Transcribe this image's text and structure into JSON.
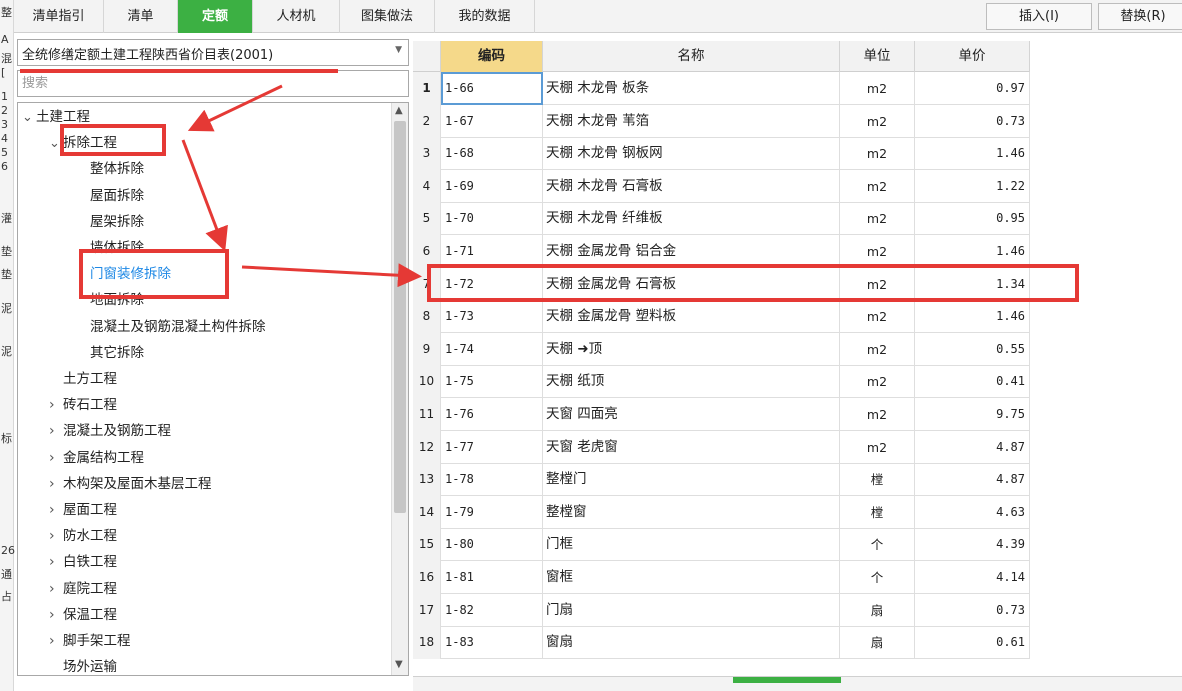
{
  "tabs": [
    {
      "label": "清单指引",
      "active": false
    },
    {
      "label": "清单",
      "active": false
    },
    {
      "label": "定额",
      "active": true
    },
    {
      "label": "人材机",
      "active": false
    },
    {
      "label": "图集做法",
      "active": false
    },
    {
      "label": "我的数据",
      "active": false
    }
  ],
  "toolbar": {
    "insert_label": "插入(I)",
    "replace_label": "替换(R)"
  },
  "edge_strip": [
    "整",
    "A",
    "混",
    "[",
    "1",
    "2",
    "3",
    "4",
    "5",
    "6",
    "灌",
    "垫",
    "垫",
    "泥",
    "泥",
    "标",
    "26",
    "通",
    "占"
  ],
  "library": {
    "selected": "全统修缮定额土建工程陕西省价目表(2001)"
  },
  "search": {
    "placeholder": "搜索"
  },
  "tree": [
    {
      "label": "土建工程",
      "level": 0,
      "chevron": "down"
    },
    {
      "label": "拆除工程",
      "level": 1,
      "chevron": "down"
    },
    {
      "label": "整体拆除",
      "level": 2,
      "chevron": ""
    },
    {
      "label": "屋面拆除",
      "level": 2,
      "chevron": ""
    },
    {
      "label": "屋架拆除",
      "level": 2,
      "chevron": ""
    },
    {
      "label": "墙体拆除",
      "level": 2,
      "chevron": ""
    },
    {
      "label": "门窗装修拆除",
      "level": 2,
      "chevron": "",
      "selected": true
    },
    {
      "label": "地面拆除",
      "level": 2,
      "chevron": ""
    },
    {
      "label": "混凝土及钢筋混凝土构件拆除",
      "level": 2,
      "chevron": ""
    },
    {
      "label": "其它拆除",
      "level": 2,
      "chevron": ""
    },
    {
      "label": "土方工程",
      "level": 1,
      "chevron": ""
    },
    {
      "label": "砖石工程",
      "level": 1,
      "chevron": "right"
    },
    {
      "label": "混凝土及钢筋工程",
      "level": 1,
      "chevron": "right"
    },
    {
      "label": "金属结构工程",
      "level": 1,
      "chevron": "right"
    },
    {
      "label": "木构架及屋面木基层工程",
      "level": 1,
      "chevron": "right"
    },
    {
      "label": "屋面工程",
      "level": 1,
      "chevron": "right"
    },
    {
      "label": "防水工程",
      "level": 1,
      "chevron": "right"
    },
    {
      "label": "白铁工程",
      "level": 1,
      "chevron": "right"
    },
    {
      "label": "庭院工程",
      "level": 1,
      "chevron": "right"
    },
    {
      "label": "保温工程",
      "level": 1,
      "chevron": "right"
    },
    {
      "label": "脚手架工程",
      "level": 1,
      "chevron": "right"
    },
    {
      "label": "场外运输",
      "level": 1,
      "chevron": ""
    }
  ],
  "grid": {
    "headers": {
      "code": "编码",
      "name": "名称",
      "unit": "单位",
      "price": "单价"
    },
    "rows": [
      {
        "idx": "1",
        "code": "1-66",
        "name": "天棚 木龙骨 板条",
        "unit": "m2",
        "price": "0.97"
      },
      {
        "idx": "2",
        "code": "1-67",
        "name": "天棚 木龙骨 苇箔",
        "unit": "m2",
        "price": "0.73"
      },
      {
        "idx": "3",
        "code": "1-68",
        "name": "天棚 木龙骨 钢板网",
        "unit": "m2",
        "price": "1.46"
      },
      {
        "idx": "4",
        "code": "1-69",
        "name": "天棚 木龙骨 石膏板",
        "unit": "m2",
        "price": "1.22"
      },
      {
        "idx": "5",
        "code": "1-70",
        "name": "天棚 木龙骨 纤维板",
        "unit": "m2",
        "price": "0.95"
      },
      {
        "idx": "6",
        "code": "1-71",
        "name": "天棚 金属龙骨 铝合金",
        "unit": "m2",
        "price": "1.46"
      },
      {
        "idx": "7",
        "code": "1-72",
        "name": "天棚 金属龙骨 石膏板",
        "unit": "m2",
        "price": "1.34"
      },
      {
        "idx": "8",
        "code": "1-73",
        "name": "天棚 金属龙骨 塑料板",
        "unit": "m2",
        "price": "1.46"
      },
      {
        "idx": "9",
        "code": "1-74",
        "name": "天棚 ➜顶",
        "unit": "m2",
        "price": "0.55"
      },
      {
        "idx": "10",
        "code": "1-75",
        "name": "天棚 纸顶",
        "unit": "m2",
        "price": "0.41"
      },
      {
        "idx": "11",
        "code": "1-76",
        "name": "天窗 四面亮",
        "unit": "m2",
        "price": "9.75"
      },
      {
        "idx": "12",
        "code": "1-77",
        "name": "天窗 老虎窗",
        "unit": "m2",
        "price": "4.87"
      },
      {
        "idx": "13",
        "code": "1-78",
        "name": "整樘门",
        "unit": "樘",
        "price": "4.87"
      },
      {
        "idx": "14",
        "code": "1-79",
        "name": "整樘窗",
        "unit": "樘",
        "price": "4.63"
      },
      {
        "idx": "15",
        "code": "1-80",
        "name": "门框",
        "unit": "个",
        "price": "4.39"
      },
      {
        "idx": "16",
        "code": "1-81",
        "name": "窗框",
        "unit": "个",
        "price": "4.14"
      },
      {
        "idx": "17",
        "code": "1-82",
        "name": "门扇",
        "unit": "扇",
        "price": "0.73"
      },
      {
        "idx": "18",
        "code": "1-83",
        "name": "窗扇",
        "unit": "扇",
        "price": "0.61"
      }
    ]
  },
  "colors": {
    "accent": "#3cb043",
    "annotation": "#e53935",
    "selected_text": "#1e88e5",
    "code_header": "#f5d98a"
  }
}
